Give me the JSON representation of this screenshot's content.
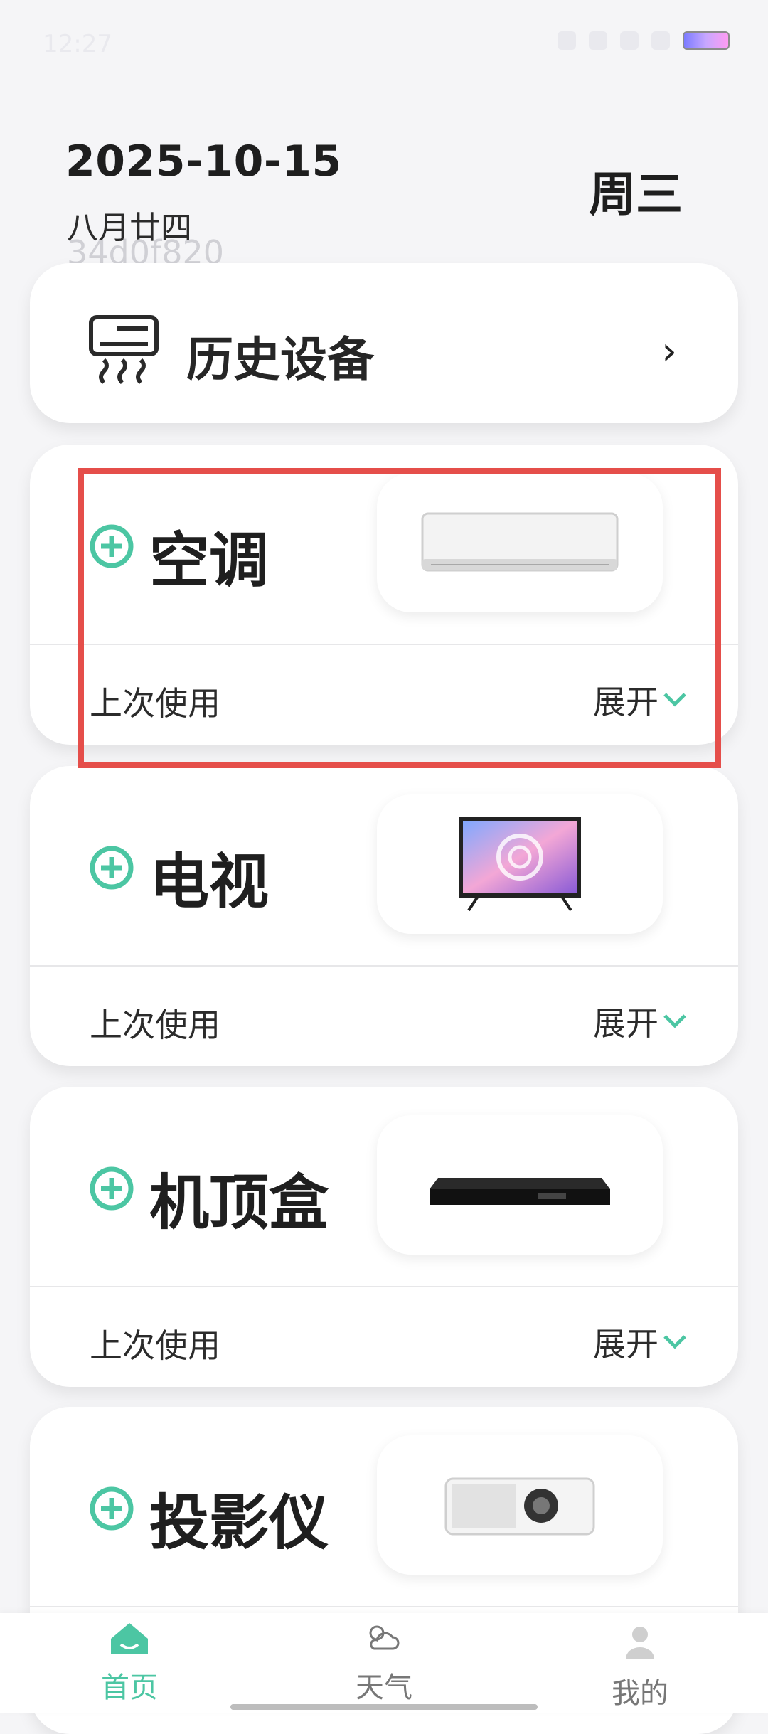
{
  "status": {
    "time": "12:27"
  },
  "header": {
    "date": "2025-10-15",
    "lunar": "八月廿四",
    "code": "34d0f820",
    "weekday": "周三"
  },
  "history": {
    "title": "历史设备",
    "icon": "air-conditioner-icon"
  },
  "devices": [
    {
      "name": "空调",
      "last_used": "上次使用",
      "expand": "展开",
      "image": "air-conditioner-image"
    },
    {
      "name": "电视",
      "last_used": "上次使用",
      "expand": "展开",
      "image": "television-image"
    },
    {
      "name": "机顶盒",
      "last_used": "上次使用",
      "expand": "展开",
      "image": "set-top-box-image"
    },
    {
      "name": "投影仪",
      "last_used": "",
      "expand": "",
      "image": "projector-image"
    }
  ],
  "nav": {
    "home": "首页",
    "weather": "天气",
    "me": "我的"
  },
  "colors": {
    "accent": "#4cc6a3",
    "highlight": "#e54e4a",
    "background": "#f5f5f7"
  }
}
